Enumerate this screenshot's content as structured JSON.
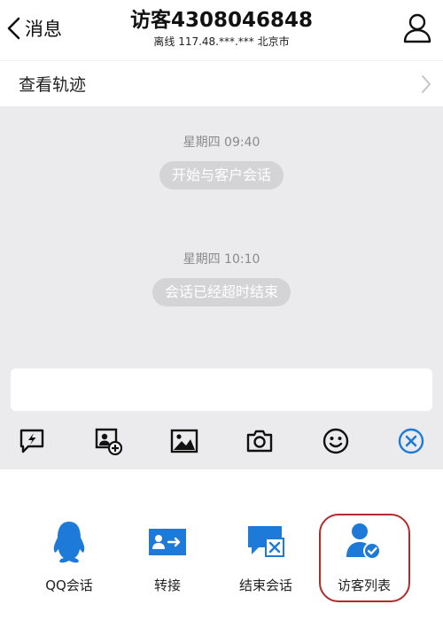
{
  "header": {
    "back_label": "消息",
    "title": "访客4308046848",
    "status": "离线",
    "ip": "117.48.***.***",
    "city": "北京市"
  },
  "track": {
    "label": "查看轨迹"
  },
  "chat": {
    "messages": [
      {
        "time": "星期四 09:40",
        "text": "开始与客户会话"
      },
      {
        "time": "星期四 10:10",
        "text": "会话已经超时结束"
      }
    ]
  },
  "input": {
    "value": "",
    "placeholder": ""
  },
  "toolbar": {
    "icons": [
      "quick-reply-icon",
      "card-add-icon",
      "image-icon",
      "camera-icon",
      "emoji-icon",
      "close-circle-icon"
    ]
  },
  "actions": [
    {
      "label": "QQ会话",
      "icon": "qq-penguin-icon"
    },
    {
      "label": "转接",
      "icon": "transfer-icon"
    },
    {
      "label": "结束会话",
      "icon": "end-session-icon"
    },
    {
      "label": "访客列表",
      "icon": "visitor-list-icon"
    }
  ],
  "colors": {
    "accent_blue": "#1d7ad8",
    "highlight_red": "#b22a2a",
    "chat_bg": "#ebebed"
  }
}
